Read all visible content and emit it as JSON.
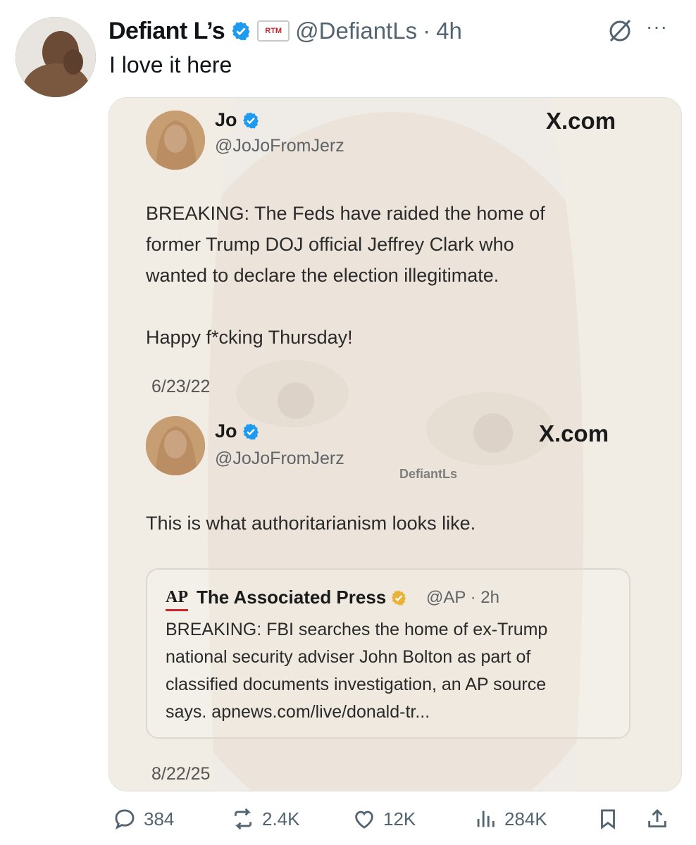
{
  "post": {
    "author_name": "Defiant L’s",
    "badge_text": "RTM",
    "handle": "@DefiantLs",
    "separator": "·",
    "time": "4h",
    "text": "I love it here",
    "more": "···"
  },
  "media": {
    "first_tweet": {
      "name": "Jo",
      "handle": "@JoJoFromJerz",
      "site": "X.com",
      "body_line1": "BREAKING: The Feds have raided the home of",
      "body_line2": "former Trump DOJ official Jeffrey Clark who",
      "body_line3": "wanted to declare the election illegitimate.",
      "body_line4": "Happy f*cking Thursday!",
      "date": "6/23/22"
    },
    "second_tweet": {
      "name": "Jo",
      "handle": "@JoJoFromJerz",
      "site": "X.com",
      "body": "This is what authoritarianism looks like.",
      "date": "8/22/25"
    },
    "watermark": "DefiantLs",
    "quote": {
      "logo": "AP",
      "name": "The Associated Press",
      "meta": "@AP · 2h",
      "line1": "BREAKING: FBI searches the home of ex-Trump",
      "line2": "national security adviser John Bolton as part of",
      "line3": "classified documents investigation, an AP source",
      "line4": "says. apnews.com/live/donald-tr..."
    }
  },
  "actions": {
    "replies": "384",
    "reposts": "2.4K",
    "likes": "12K",
    "views": "284K"
  },
  "colors": {
    "verified_blue": "#1d9bf0",
    "verified_gold": "#e8b339",
    "muted_text": "#536471"
  },
  "icons": [
    "verified-icon",
    "grok-icon",
    "more-icon",
    "reply-icon",
    "repost-icon",
    "like-icon",
    "views-icon",
    "bookmark-icon",
    "share-icon"
  ]
}
